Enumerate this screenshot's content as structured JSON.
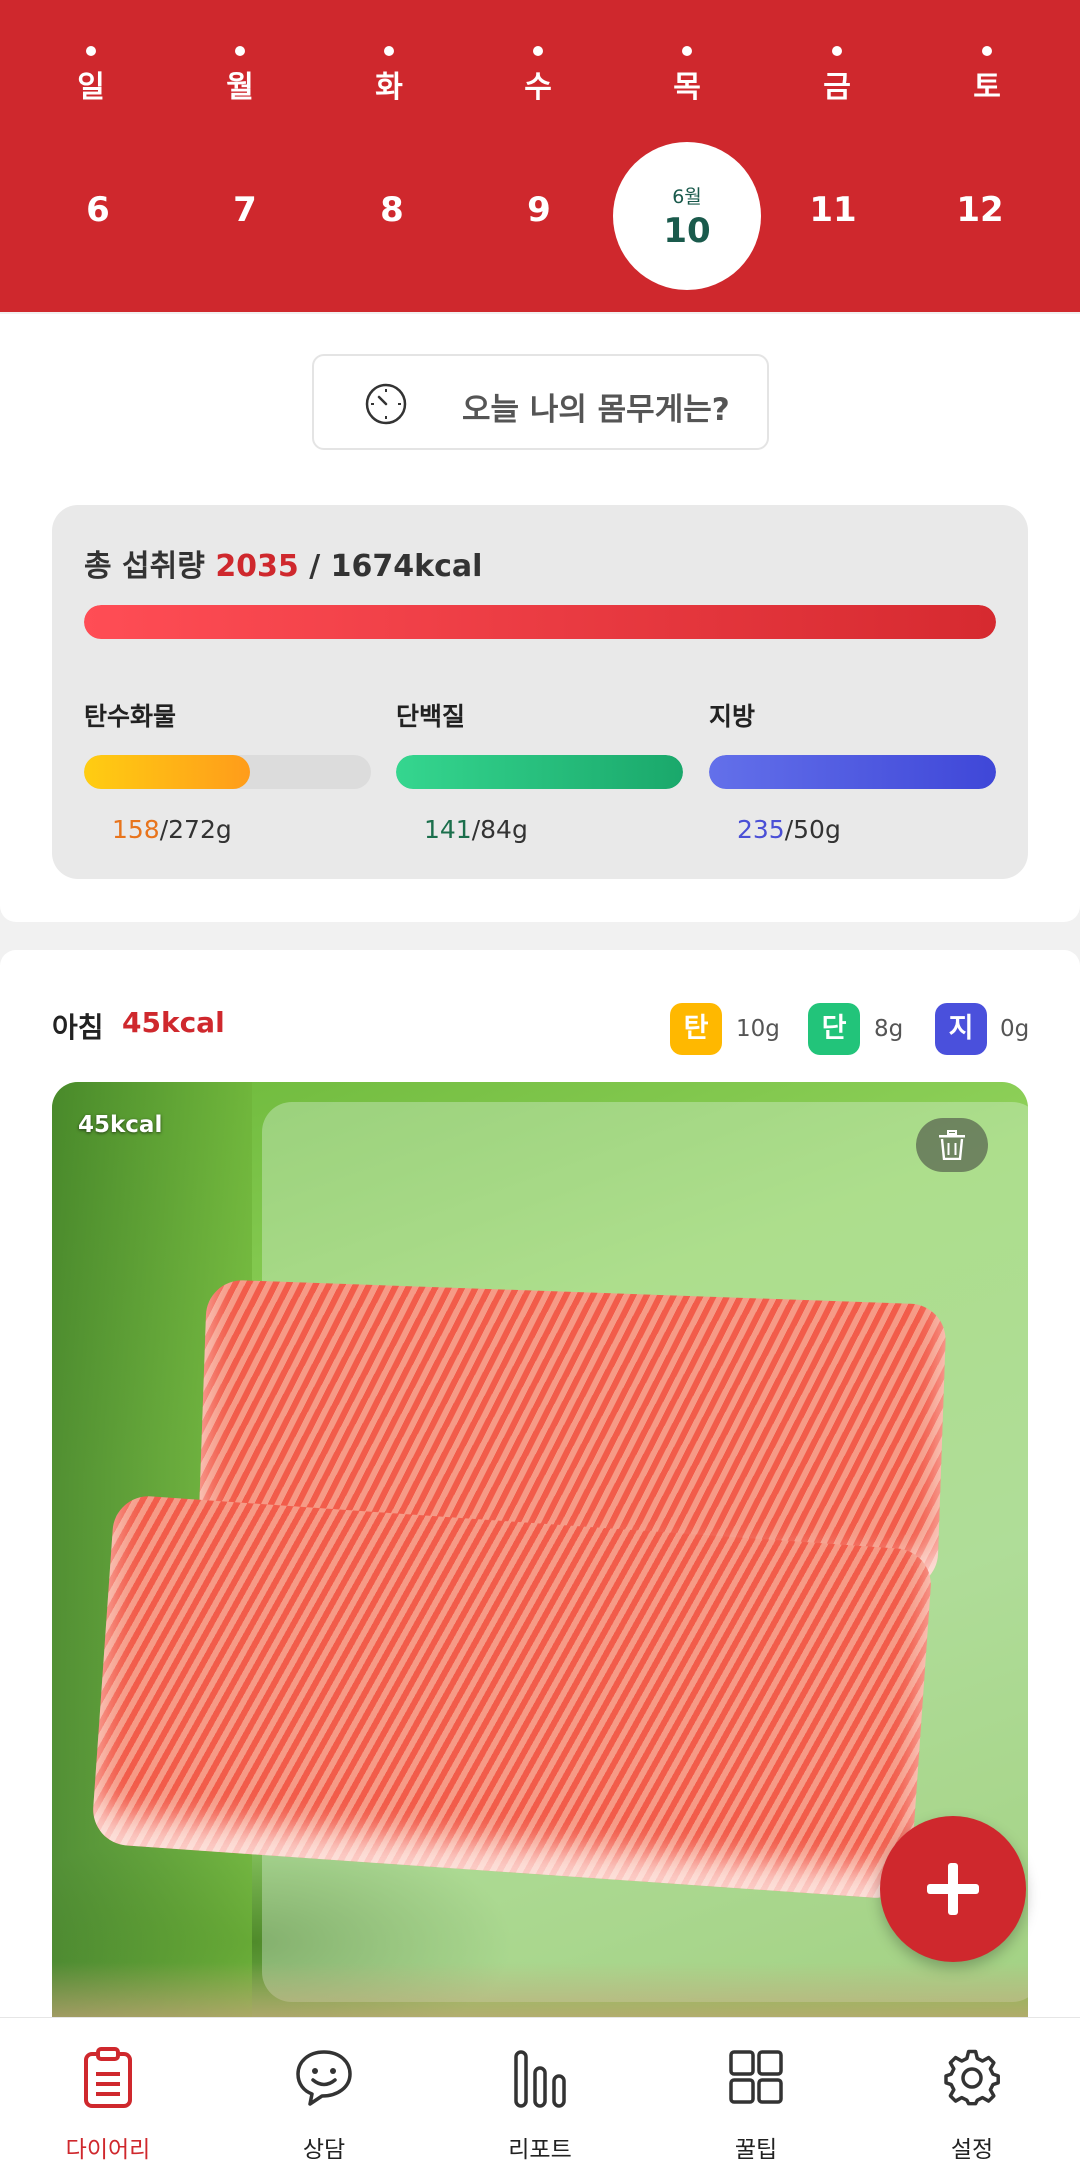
{
  "calendar": {
    "weekdays": [
      "일",
      "월",
      "화",
      "수",
      "목",
      "금",
      "토"
    ],
    "dates": [
      "6",
      "7",
      "8",
      "9",
      "10",
      "11",
      "12"
    ],
    "selected": {
      "month_label": "6월",
      "day": "10"
    }
  },
  "weight_button": {
    "label": "오늘 나의 몸무게는?"
  },
  "intake": {
    "label": "총 섭취량",
    "current": "2035",
    "target_text": "/ 1674kcal",
    "progress": 1.0,
    "macros": [
      {
        "name": "탄수화물",
        "value": "158",
        "target": "/272g",
        "progress": 0.58,
        "color": "#e8741c",
        "gradient_from": "#ffcd12",
        "gradient_to": "#ff9c1a"
      },
      {
        "name": "단백질",
        "value": "141",
        "target": "/84g",
        "progress": 1.0,
        "color": "#1b6f4c",
        "gradient_from": "#35d68f",
        "gradient_to": "#1aa86b"
      },
      {
        "name": "지방",
        "value": "235",
        "target": "/50g",
        "progress": 1.0,
        "color": "#4a4fd6",
        "gradient_from": "#6370ea",
        "gradient_to": "#3f47d8"
      }
    ]
  },
  "meal": {
    "title": "아침",
    "kcal": "45kcal",
    "badges": [
      {
        "letter": "탄",
        "value": "10g",
        "color": "#ffb800"
      },
      {
        "letter": "단",
        "value": "8g",
        "color": "#22c47a"
      },
      {
        "letter": "지",
        "value": "0g",
        "color": "#4a50dc"
      }
    ],
    "photo_kcal": "45kcal"
  },
  "nav": [
    {
      "label": "다이어리",
      "icon": "clipboard-icon",
      "active": true
    },
    {
      "label": "상담",
      "icon": "chat-smile-icon",
      "active": false
    },
    {
      "label": "리포트",
      "icon": "bar-chart-icon",
      "active": false
    },
    {
      "label": "꿀팁",
      "icon": "grid-icon",
      "active": false
    },
    {
      "label": "설정",
      "icon": "gear-icon",
      "active": false
    }
  ],
  "colors": {
    "accent": "#cf282d"
  }
}
